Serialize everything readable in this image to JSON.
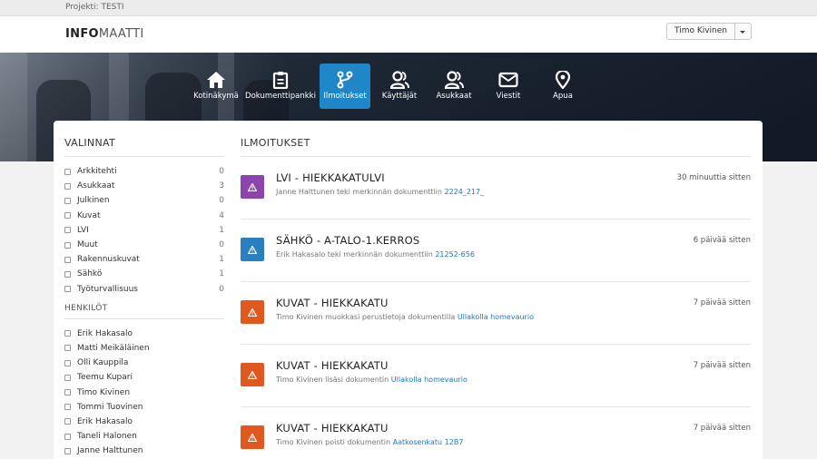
{
  "topbar": {
    "project": "Projekti: TESTI"
  },
  "header": {
    "logo_bold": "INFO",
    "logo_light": "MAATTI",
    "user_name": "Timo Kivinen"
  },
  "nav": [
    {
      "label": "Kotinäkymä",
      "icon": "home-icon",
      "active": false
    },
    {
      "label": "Dokumenttipankki",
      "icon": "clipboard-icon",
      "active": false
    },
    {
      "label": "Ilmoitukset",
      "icon": "branch-icon",
      "active": true
    },
    {
      "label": "Käyttäjät",
      "icon": "users-icon",
      "active": false
    },
    {
      "label": "Asukkaat",
      "icon": "residents-icon",
      "active": false
    },
    {
      "label": "Viestit",
      "icon": "envelope-icon",
      "active": false
    },
    {
      "label": "Apua",
      "icon": "map-pin-icon",
      "active": false
    }
  ],
  "sidebar": {
    "title": "VALINNAT",
    "categories": [
      {
        "label": "Arkkitehti",
        "count": "0"
      },
      {
        "label": "Asukkaat",
        "count": "3"
      },
      {
        "label": "Julkinen",
        "count": "0"
      },
      {
        "label": "Kuvat",
        "count": "4"
      },
      {
        "label": "LVI",
        "count": "1"
      },
      {
        "label": "Muut",
        "count": "0"
      },
      {
        "label": "Rakennuskuvat",
        "count": "1"
      },
      {
        "label": "Sähkö",
        "count": "1"
      },
      {
        "label": "Työturvallisuus",
        "count": "0"
      }
    ],
    "persons_title": "HENKILÖT",
    "persons": [
      "Erik Hakasalo",
      "Matti Meikäläinen",
      "Olli Kauppila",
      "Teemu Kupari",
      "Timo Kivinen",
      "Tommi Tuovinen",
      "Erik Hakasalo",
      "Taneli Halonen",
      "Janne Halttunen"
    ]
  },
  "main": {
    "title": "ILMOITUKSET",
    "notices": [
      {
        "title": "LVI - HIEKKAKATULVI",
        "text": "Janne Halttunen teki merkinnän dokumenttiin",
        "link": "2224_217_",
        "time": "30 minuuttia sitten",
        "color": "#8e44ad"
      },
      {
        "title": "SÄHKÖ - A-TALO-1.KERROS",
        "text": "Erik Hakasalo teki merkinnän dokumenttiin",
        "link": "21252-656",
        "time": "6 päivää sitten",
        "color": "#2a7fc0"
      },
      {
        "title": "KUVAT - HIEKKAKATU",
        "text": "Timo Kivinen muokkasi perustietoja dokumentilla",
        "link": "Ullakolla homevaurio",
        "time": "7 päivää sitten",
        "color": "#e0581d"
      },
      {
        "title": "KUVAT - HIEKKAKATU",
        "text": "Timo Kivinen lisäsi dokumentin",
        "link": "Ullakolla homevaurio",
        "time": "7 päivää sitten",
        "color": "#e0581d"
      },
      {
        "title": "KUVAT - HIEKKAKATU",
        "text": "Timo Kivinen poisti dokumentin",
        "link": "Aatkosenkatu 12B7",
        "time": "7 päivää sitten",
        "color": "#e0581d"
      }
    ]
  }
}
